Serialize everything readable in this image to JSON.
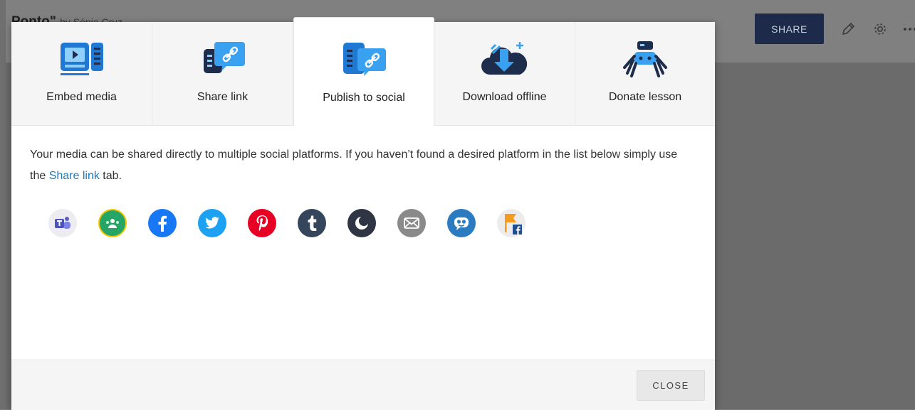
{
  "background": {
    "title": "Ponto\"",
    "byline": "by Sónia Cruz",
    "share_label": "SHARE",
    "edit_icon": "pencil-icon",
    "settings_icon": "gear-icon",
    "more_icon": "more-dots-icon"
  },
  "modal": {
    "tabs": [
      {
        "label": "Embed media",
        "icon": "embed-media-icon"
      },
      {
        "label": "Share link",
        "icon": "share-link-icon"
      },
      {
        "label": "Publish to social",
        "icon": "publish-social-icon",
        "active": true
      },
      {
        "label": "Download offline",
        "icon": "download-offline-icon"
      },
      {
        "label": "Donate lesson",
        "icon": "donate-lesson-icon"
      }
    ],
    "description_before": "Your media can be shared directly to multiple social platforms. If you haven’t found a desired platform in the list below simply use the ",
    "description_link": "Share link",
    "description_after": " tab.",
    "socials": [
      {
        "name": "Microsoft Teams",
        "icon": "teams-icon",
        "color": "#ececf1"
      },
      {
        "name": "Google Classroom",
        "icon": "google-classroom-icon",
        "color": "#25a667"
      },
      {
        "name": "Facebook",
        "icon": "facebook-icon",
        "color": "#1877f2"
      },
      {
        "name": "Twitter",
        "icon": "twitter-icon",
        "color": "#1da1f2"
      },
      {
        "name": "Pinterest",
        "icon": "pinterest-icon",
        "color": "#e60023"
      },
      {
        "name": "Tumblr",
        "icon": "tumblr-icon",
        "color": "#35465c"
      },
      {
        "name": "Moodle",
        "icon": "moon-icon",
        "color": "#2f3542"
      },
      {
        "name": "Email",
        "icon": "email-icon",
        "color": "#8a8a8a"
      },
      {
        "name": "Edmodo",
        "icon": "edmodo-icon",
        "color": "#2a7bc0"
      },
      {
        "name": "Workplace",
        "icon": "workplace-flag-icon",
        "color": "#ececec"
      }
    ],
    "close_label": "CLOSE"
  }
}
